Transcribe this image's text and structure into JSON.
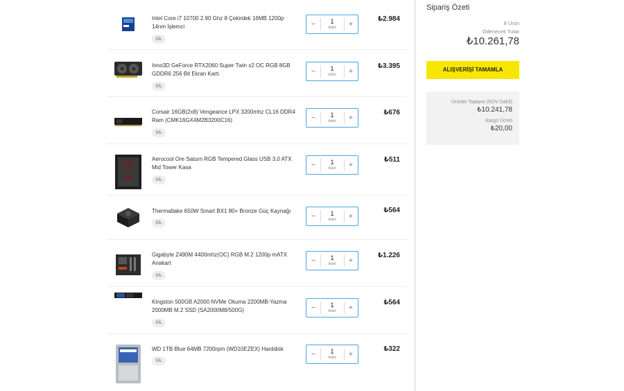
{
  "items": [
    {
      "name": "Intel Core i7 10700 2.90 Ghz 8 Çekirdek 16MB 1200p 14nm İşlemci",
      "remove_label": "SİL",
      "qty": "1",
      "unit": "Adet",
      "price": "₺2.984",
      "icon": "cpu-box-icon"
    },
    {
      "name": "Inno3D GeForce RTX2060 Super Twin x2 OC RGB 8GB GDDR6 256 Bit Ekran Kartı",
      "remove_label": "SİL",
      "qty": "1",
      "unit": "Adet",
      "price": "₺3.395",
      "icon": "graphics-card-icon"
    },
    {
      "name": "Corsair 16GB(2x8) Vengeance LPX 3200mhz CL16 DDR4 Ram (CMK16GX4M2B3200C16)",
      "remove_label": "SİL",
      "qty": "1",
      "unit": "Adet",
      "price": "₺676",
      "icon": "ram-icon"
    },
    {
      "name": "Aerocool Ore Saturn RGB Tempered Glass USB 3.0 ATX Mid Tower Kasa",
      "remove_label": "SİL",
      "qty": "1",
      "unit": "Adet",
      "price": "₺511",
      "icon": "pc-case-icon"
    },
    {
      "name": "Thermaltake 650W Smart BX1 80+ Bronze Güç Kaynağı",
      "remove_label": "SİL",
      "qty": "1",
      "unit": "Adet",
      "price": "₺564",
      "icon": "power-supply-icon"
    },
    {
      "name": "Gigabyte Z490M 4400mhz(OC) RGB M.2 1200p mATX Anakart",
      "remove_label": "SİL",
      "qty": "1",
      "unit": "Adet",
      "price": "₺1.226",
      "icon": "motherboard-icon"
    },
    {
      "name": "Kingston 500GB A2000 NVMe Okuma 2200MB-Yazma 2000MB M.2 SSD (SA2000M8/500G)",
      "remove_label": "SİL",
      "qty": "1",
      "unit": "Adet",
      "price": "₺564",
      "icon": "ssd-icon"
    },
    {
      "name": "WD 1TB Blue 64MB 7200rpm (WD10EZEX) Harddisk",
      "remove_label": "SİL",
      "qty": "1",
      "unit": "Adet",
      "price": "₺322",
      "icon": "hard-disk-icon"
    }
  ],
  "summary": {
    "title": "Sipariş Özeti",
    "count": "8 Ürün",
    "payable_label": "Ödenecek Tutar",
    "payable_total": "₺10.261,78",
    "checkout_label": "ALIŞVERİŞİ TAMAMLA",
    "products_total_label": "Ürünler Toplamı (KDV Dahil)",
    "products_total": "₺10.241,78",
    "shipping_label": "Kargo Ücreti",
    "shipping": "₺20,00"
  },
  "colors": {
    "accent_button": "#f7e600",
    "stepper_border": "#4aa3df",
    "summary_box": "#f2f2f2"
  }
}
